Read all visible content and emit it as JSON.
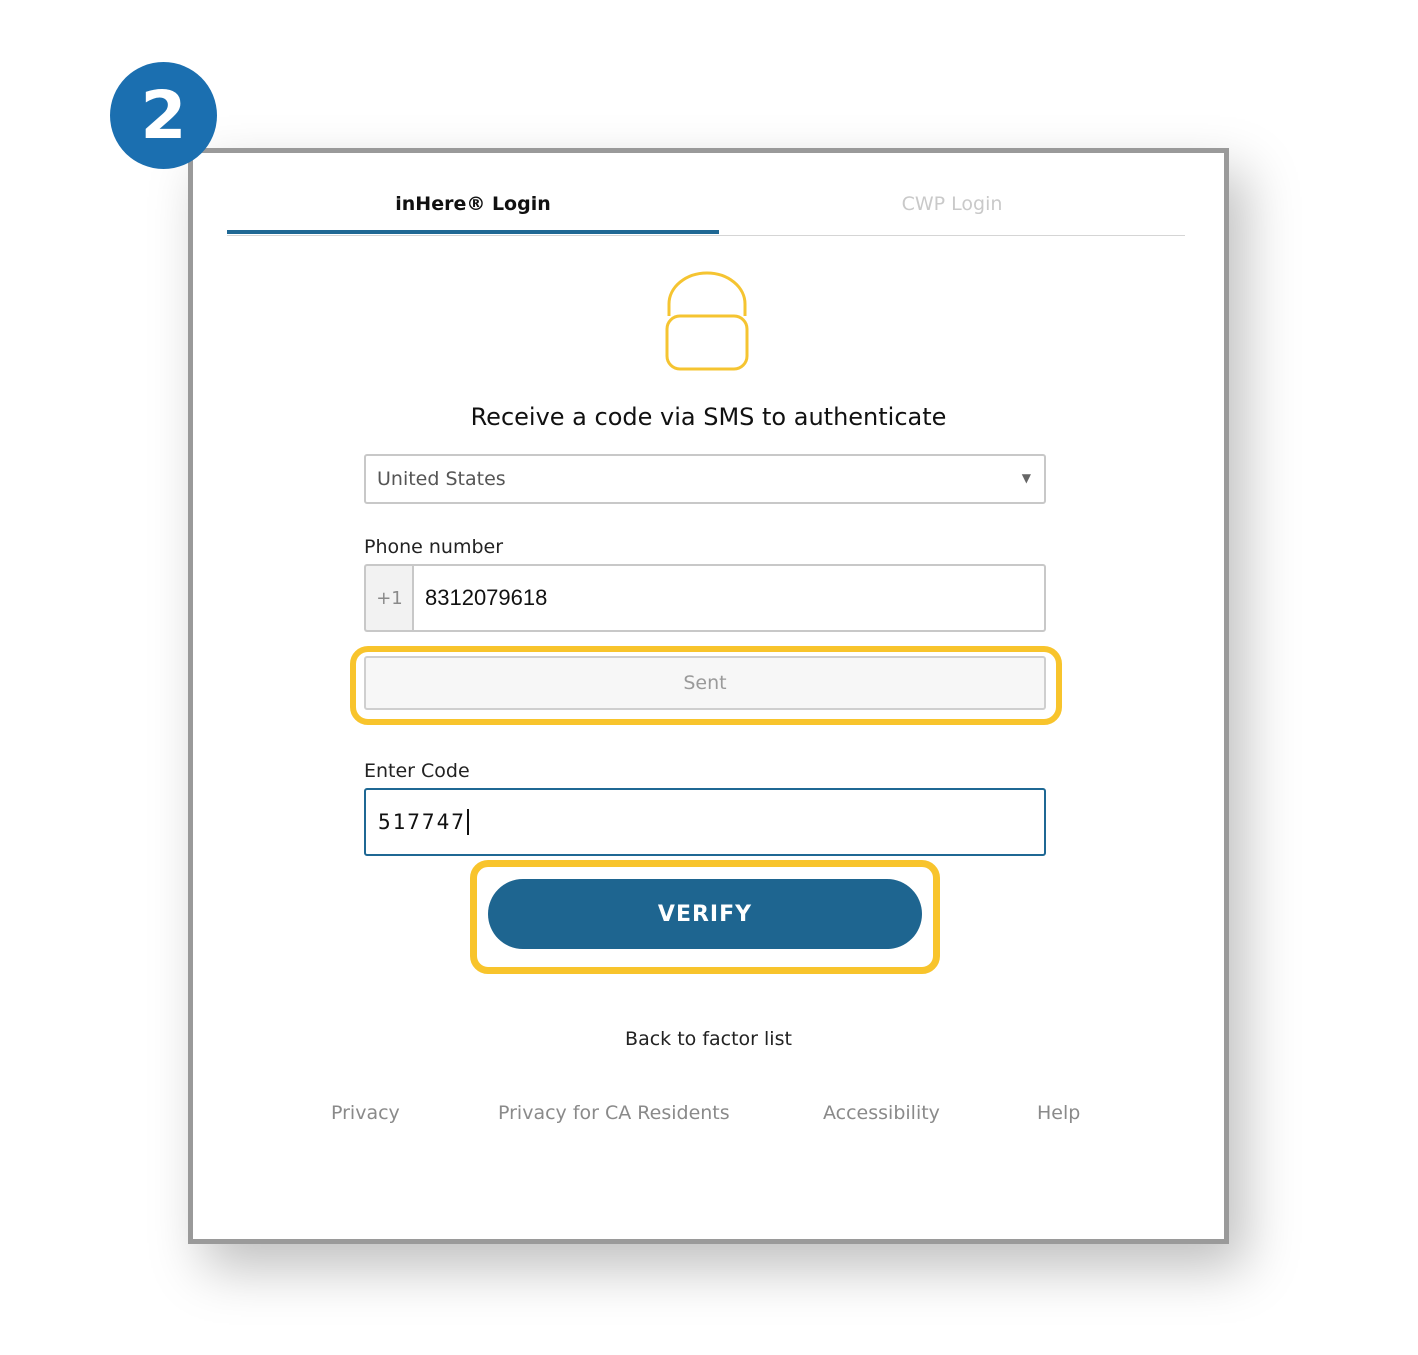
{
  "badge": {
    "number": "2"
  },
  "tabs": [
    {
      "label": "inHere® Login",
      "active": true
    },
    {
      "label": "CWP Login",
      "active": false
    }
  ],
  "icon": {
    "lock": "lock-icon"
  },
  "heading": "Receive a code via SMS to authenticate",
  "country": {
    "selected": "United States"
  },
  "phone": {
    "label": "Phone number",
    "prefix": "+1",
    "value": "8312079618"
  },
  "send_button": {
    "label": "Sent"
  },
  "code": {
    "label": "Enter Code",
    "value": "517747"
  },
  "verify_button": {
    "label": "VERIFY"
  },
  "back_link": "Back to factor list",
  "footer": {
    "privacy": "Privacy",
    "privacy_ca": "Privacy for CA Residents",
    "accessibility": "Accessibility",
    "help": "Help"
  },
  "colors": {
    "accent": "#1e6590",
    "badge": "#1b6fb0",
    "highlight": "#f8c42c",
    "lock": "#f5c431"
  }
}
